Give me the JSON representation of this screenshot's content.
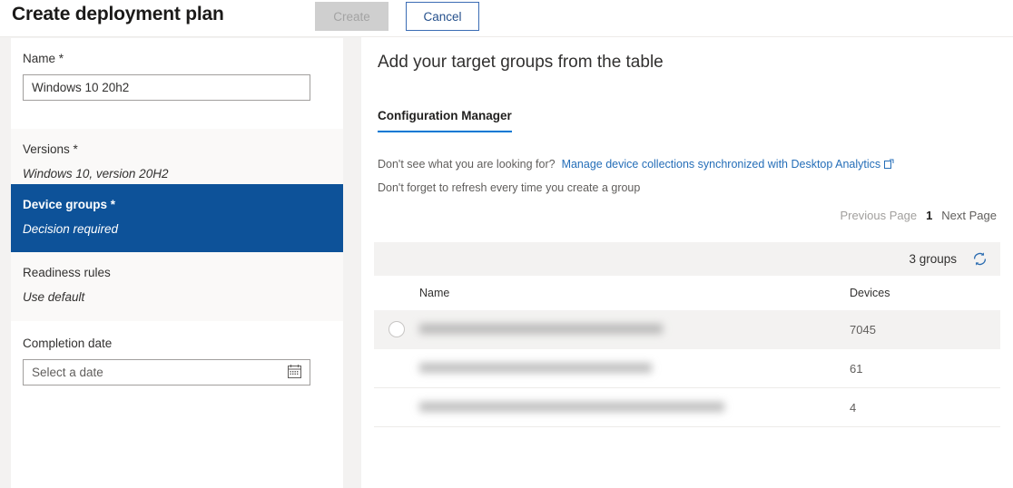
{
  "topbar": {
    "title": "Create deployment plan",
    "create_label": "Create",
    "cancel_label": "Cancel"
  },
  "sidebar": {
    "steps": [
      {
        "label": "Name",
        "required_marker": " *",
        "input_value": "Windows 10 20h2",
        "state": "white"
      },
      {
        "label": "Versions",
        "required_marker": " *",
        "value": "Windows 10, version 20H2",
        "state": "plain"
      },
      {
        "label": "Device groups",
        "required_marker": " *",
        "value": "Decision required",
        "state": "active"
      },
      {
        "label": "Readiness rules",
        "required_marker": "",
        "value": "Use default",
        "state": "plain"
      },
      {
        "label": "Completion date",
        "required_marker": "",
        "input_placeholder": "Select a date",
        "state": "white",
        "icon": "calendar-icon"
      }
    ],
    "active_color": "#0d5299"
  },
  "main": {
    "title": "Add your target groups from the table",
    "tabs": [
      {
        "label": "Configuration Manager",
        "selected": true
      }
    ],
    "hint": {
      "text": "Don't see what you are looking for?",
      "link_text": "Manage device collections synchronized with Desktop Analytics",
      "link_icon": "external-link-icon",
      "second_line": "Don't forget to refresh every time you create a group"
    },
    "pagination": {
      "previous_label": "Previous Page",
      "current_page": "1",
      "next_label": "Next Page"
    },
    "toolbar": {
      "count_label": "3 groups",
      "refresh_icon": "refresh-icon"
    },
    "table": {
      "columns": [
        "Name",
        "Devices"
      ],
      "rows": [
        {
          "name": "",
          "devices": "7045",
          "selected": true
        },
        {
          "name": "",
          "devices": "61",
          "selected": false
        },
        {
          "name": "",
          "devices": "4",
          "selected": false
        }
      ]
    }
  },
  "colors": {
    "accent": "#0078d4",
    "active_step": "#0d5299",
    "link": "#256eb8",
    "required": "#a4262c"
  }
}
